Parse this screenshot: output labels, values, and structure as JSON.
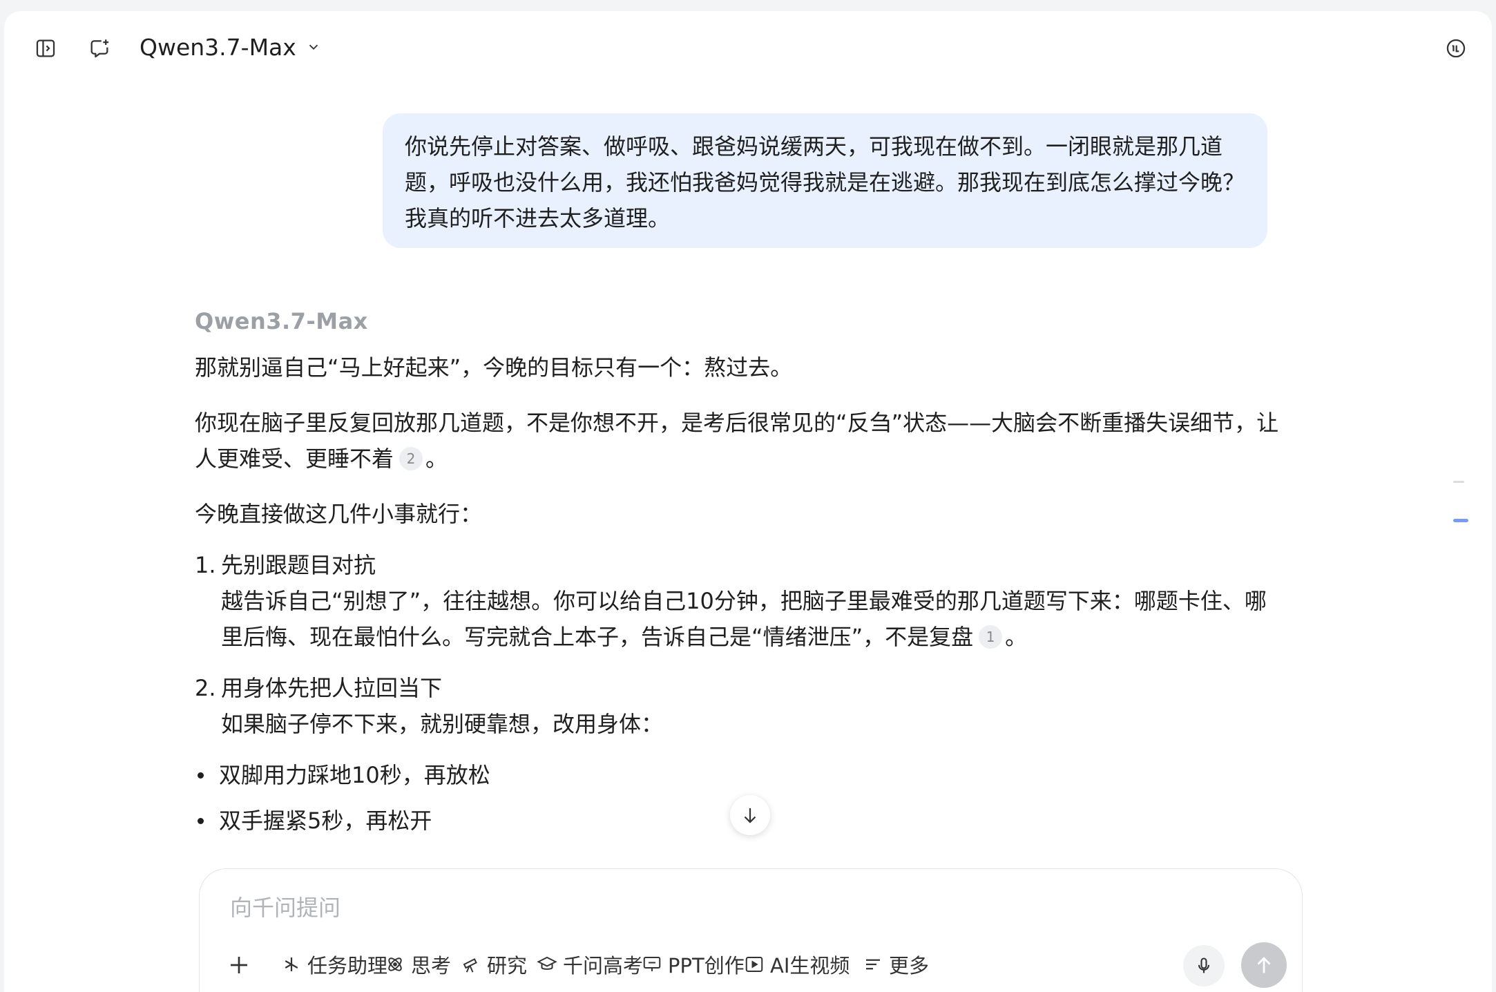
{
  "header": {
    "model_name": "Qwen3.7-Max"
  },
  "user_message": {
    "text": "你说先停止对答案、做呼吸、跟爸妈说缓两天，可我现在做不到。一闭眼就是那几道题，呼吸也没什么用，我还怕我爸妈觉得我就是在逃避。那我现在到底怎么撑过今晚？我真的听不进去太多道理。"
  },
  "assistant": {
    "name": "Qwen3.7-Max",
    "p1": "那就别逼自己“马上好起来”，今晚的目标只有一个：熬过去。",
    "p2": "你现在脑子里反复回放那几道题，不是你想不开，是考后很常见的“反刍”状态——大脑会不断重播失误细节，让人更难受、更睡不着",
    "p2_cite": "2",
    "p2_end": "。",
    "p3": "今晚直接做这几件小事就行：",
    "list": [
      {
        "num": "1.",
        "title": "先别跟题目对抗",
        "body": "越告诉自己“别想了”，往往越想。你可以给自己10分钟，把脑子里最难受的那几道题写下来：哪题卡住、哪里后悔、现在最怕什么。写完就合上本子，告诉自己是“情绪泄压”，不是复盘",
        "cite": "1",
        "end": "。"
      },
      {
        "num": "2.",
        "title": "用身体先把人拉回当下",
        "body": "如果脑子停不下来，就别硬靠想，改用身体：",
        "cite": "",
        "end": ""
      }
    ],
    "bullets": [
      "双脚用力踩地10秒，再放松",
      "双手握紧5秒，再松开"
    ]
  },
  "composer": {
    "placeholder": "向千问提问",
    "tools": [
      {
        "label": "任务助理",
        "icon": "asterisk-icon"
      },
      {
        "label": "思考",
        "icon": "atom-icon"
      },
      {
        "label": "研究",
        "icon": "telescope-icon"
      },
      {
        "label": "千问高考",
        "icon": "graduation-cap-icon"
      },
      {
        "label": "PPT创作",
        "icon": "presentation-icon"
      },
      {
        "label": "AI生视频",
        "icon": "video-play-icon"
      },
      {
        "label": "更多",
        "icon": "menu-lines-icon"
      }
    ]
  },
  "colors": {
    "user_bubble": "#e9f1fe",
    "accent": "#7a9bf2",
    "send_disabled": "#c8cacd"
  }
}
